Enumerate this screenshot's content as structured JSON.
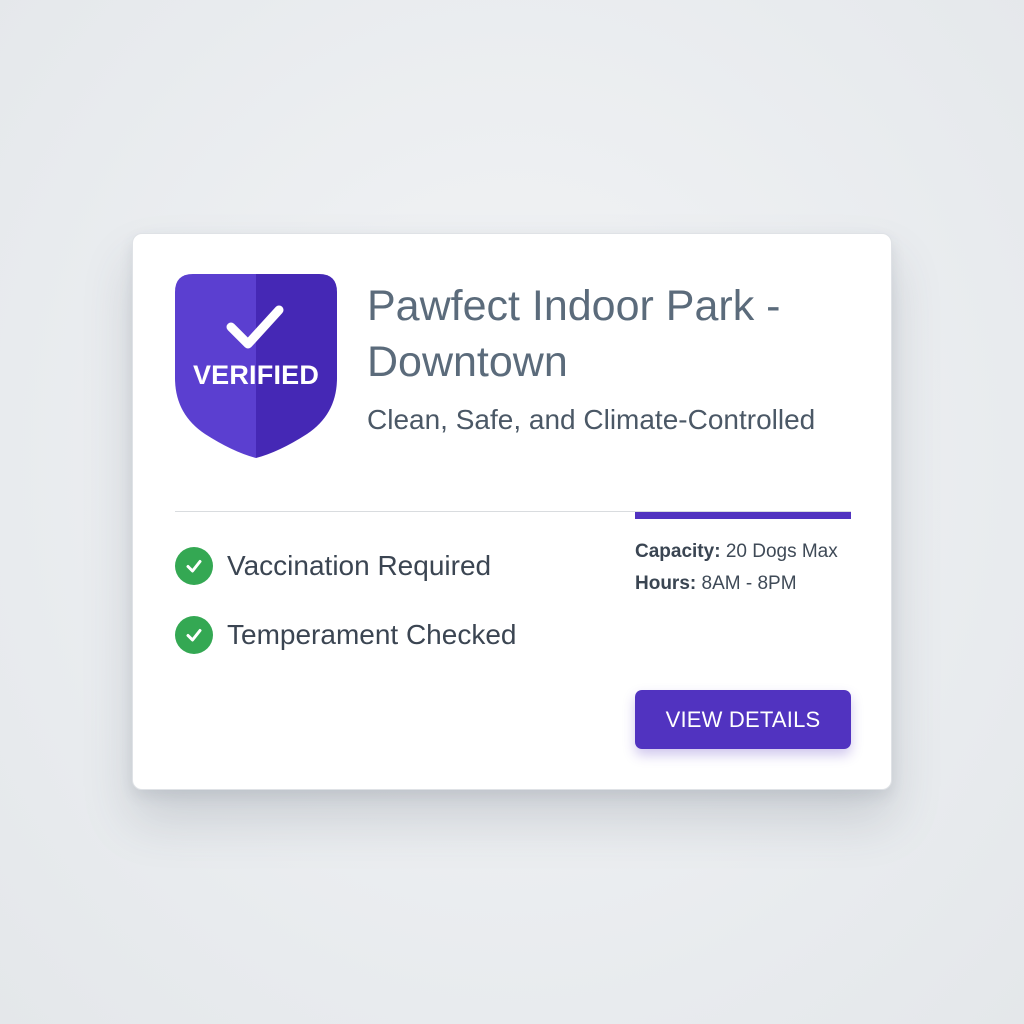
{
  "badge": {
    "label": "VERIFIED",
    "icon": "shield-check-icon",
    "color_left": "#5b3fd0",
    "color_right": "#4528b5"
  },
  "park": {
    "title": "Pawfect Indoor Park - Downtown",
    "subtitle": "Clean, Safe, and Climate-Controlled"
  },
  "requirements": [
    {
      "label": "Vaccination Required",
      "icon": "check-circle-icon"
    },
    {
      "label": "Temperament Checked",
      "icon": "check-circle-icon"
    }
  ],
  "stats": {
    "capacity_label": "Capacity:",
    "capacity_value": "20 Dogs Max",
    "hours_label": "Hours:",
    "hours_value": "8AM - 8PM"
  },
  "actions": {
    "view_details_label": "VIEW DETAILS"
  },
  "colors": {
    "accent": "#5133c0",
    "success": "#34a853",
    "title_text": "#5b6b7b"
  }
}
